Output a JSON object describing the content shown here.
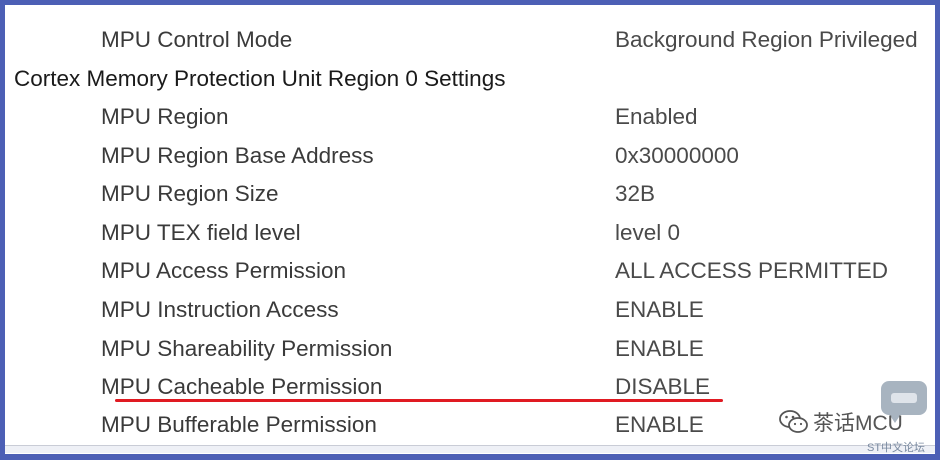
{
  "rows": [
    {
      "label": "MPU Control Mode",
      "value": "Background Region Privileged",
      "type": "item"
    },
    {
      "label": "Cortex Memory Protection Unit Region 0 Settings",
      "value": "",
      "type": "section"
    },
    {
      "label": "MPU Region",
      "value": "Enabled",
      "type": "item"
    },
    {
      "label": "MPU Region Base Address",
      "value": "0x30000000",
      "type": "item"
    },
    {
      "label": "MPU Region Size",
      "value": "32B",
      "type": "item"
    },
    {
      "label": "MPU TEX field level",
      "value": "level 0",
      "type": "item"
    },
    {
      "label": "MPU Access Permission",
      "value": "ALL ACCESS PERMITTED",
      "type": "item"
    },
    {
      "label": "MPU Instruction Access",
      "value": "ENABLE",
      "type": "item"
    },
    {
      "label": "MPU Shareability Permission",
      "value": "ENABLE",
      "type": "item"
    },
    {
      "label": "MPU Cacheable Permission",
      "value": "DISABLE",
      "type": "item"
    },
    {
      "label": "MPU Bufferable  Permission",
      "value": "ENABLE",
      "type": "item"
    }
  ],
  "highlight": {
    "row": "MPU Cacheable Permission",
    "color": "#e01a22"
  },
  "watermark": {
    "title": "茶话MCU",
    "subtitle": "ST中文论坛",
    "icon": "wechat-icon"
  },
  "colors": {
    "frame": "#4c5fb5",
    "text": "#3a3a3a"
  }
}
